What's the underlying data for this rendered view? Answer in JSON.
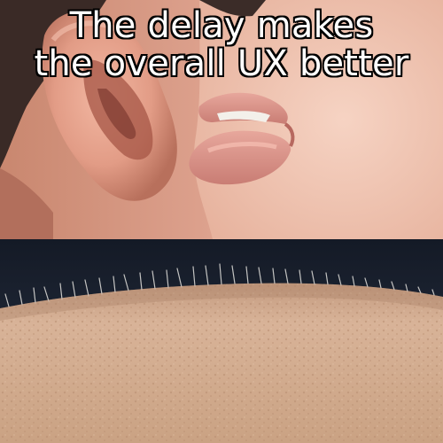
{
  "caption": {
    "line1": "The delay makes",
    "line2": "the overall UX better"
  },
  "panels": [
    {
      "id": "top",
      "subject": "ear-and-whispering-lips"
    },
    {
      "id": "bottom",
      "subject": "arm-skin-goosebumps"
    }
  ],
  "colors": {
    "skin_light": "#e9b3a0",
    "skin_mid": "#d89b88",
    "ear_shadow": "#a8574a",
    "lip": "#d9928a",
    "hair_dark": "#2a2120",
    "arm_skin": "#d7b195",
    "arm_background": "#1b2230",
    "caption_fill": "#ffffff",
    "caption_outline": "#000000"
  }
}
